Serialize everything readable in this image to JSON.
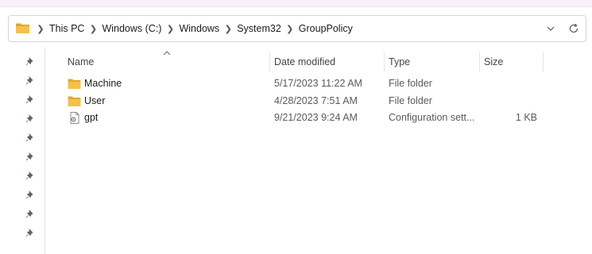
{
  "breadcrumb": {
    "items": [
      "This PC",
      "Windows (C:)",
      "Windows",
      "System32",
      "GroupPolicy"
    ]
  },
  "columns": {
    "name": "Name",
    "date_modified": "Date modified",
    "type": "Type",
    "size": "Size"
  },
  "files": [
    {
      "name": "Machine",
      "date": "5/17/2023 11:22 AM",
      "type": "File folder",
      "size": "",
      "icon": "folder-icon"
    },
    {
      "name": "User",
      "date": "4/28/2023 7:51 AM",
      "type": "File folder",
      "size": "",
      "icon": "folder-icon"
    },
    {
      "name": "gpt",
      "date": "9/21/2023 9:24 AM",
      "type": "Configuration sett...",
      "size": "1 KB",
      "icon": "config-file-icon"
    }
  ],
  "colors": {
    "folder": "#f2c14e",
    "folder_dark": "#e0a92c",
    "border": "#d6d6d6"
  }
}
